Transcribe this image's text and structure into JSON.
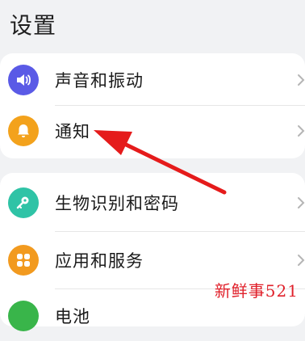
{
  "header": {
    "title": "设置"
  },
  "groups": [
    {
      "items": [
        {
          "label": "声音和振动",
          "icon": "speaker-icon",
          "icon_color": "#5a5ae6"
        },
        {
          "label": "通知",
          "icon": "bell-icon",
          "icon_color": "#f3a21c"
        }
      ]
    },
    {
      "items": [
        {
          "label": "生物识别和密码",
          "icon": "key-icon",
          "icon_color": "#2fc3a6"
        },
        {
          "label": "应用和服务",
          "icon": "apps-grid-icon",
          "icon_color": "#f29a1f"
        },
        {
          "label": "电池",
          "icon": "battery-icon",
          "icon_color": "#39b54a"
        }
      ]
    }
  ],
  "watermark": {
    "text": "新鲜事521"
  },
  "annotation": {
    "color": "#e51b1b"
  }
}
